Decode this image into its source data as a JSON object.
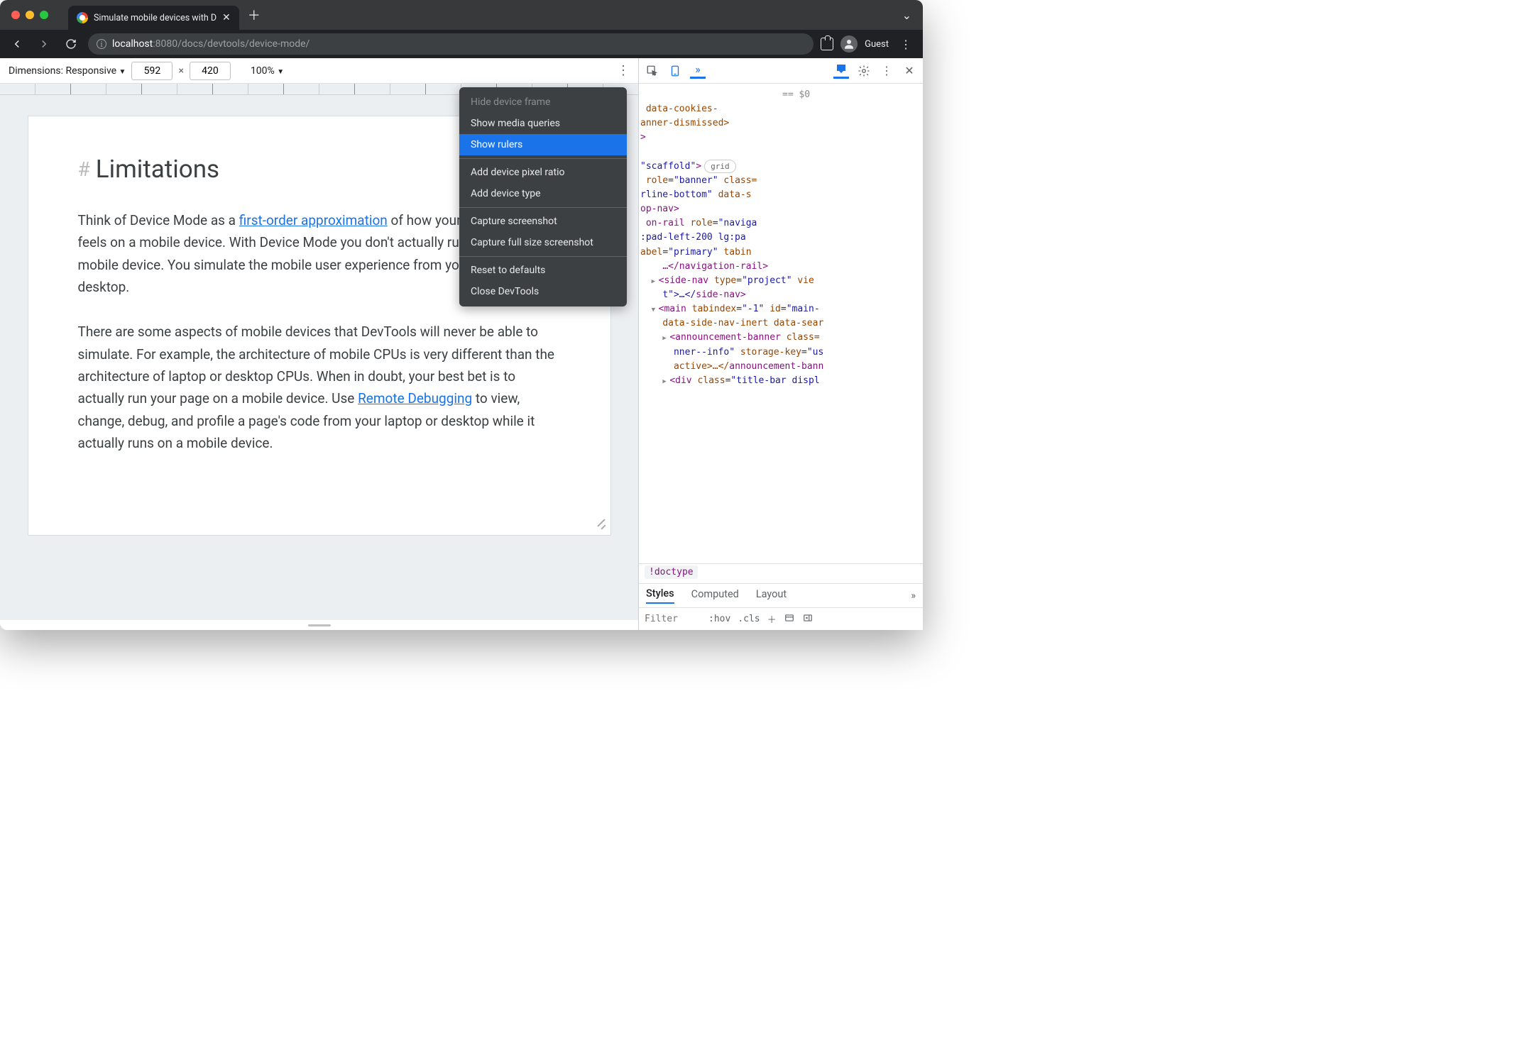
{
  "tab": {
    "title": "Simulate mobile devices with D"
  },
  "url": {
    "host": "localhost",
    "port": ":8080",
    "path": "/docs/devtools/device-mode/"
  },
  "profile": {
    "label": "Guest"
  },
  "device_toolbar": {
    "dimensions_label": "Dimensions: Responsive",
    "width": "592",
    "height": "420",
    "zoom": "100%"
  },
  "context_menu": {
    "hide_frame": "Hide device frame",
    "show_media": "Show media queries",
    "show_rulers": "Show rulers",
    "add_dpr": "Add device pixel ratio",
    "add_type": "Add device type",
    "capture": "Capture screenshot",
    "capture_full": "Capture full size screenshot",
    "reset": "Reset to defaults",
    "close": "Close DevTools"
  },
  "page": {
    "heading": "Limitations",
    "p1a": "Think of Device Mode as a ",
    "p1link": "first-order approximation",
    "p1b": " of how your page looks and feels on a mobile device. With Device Mode you don't actually run your code on a mobile device. You simulate the mobile user experience from your laptop or desktop.",
    "p2a": "There are some aspects of mobile devices that DevTools will never be able to simulate. For example, the architecture of mobile CPUs is very different than the architecture of laptop or desktop CPUs. When in doubt, your best bet is to actually run your page on a mobile device. Use ",
    "p2link": "Remote Debugging",
    "p2b": " to view, change, debug, and profile a page's code from your laptop or desktop while it actually runs on a mobile device."
  },
  "devtools": {
    "ref": "== $0",
    "breadcrumb": "!doctype",
    "filter_placeholder": "Filter",
    "hov": ":hov",
    "cls": ".cls",
    "tabs": {
      "styles": "Styles",
      "computed": "Computed",
      "layout": "Layout"
    },
    "tree": {
      "l1": " data-cookies-",
      "l1b": "anner-dismissed>",
      "l2a": "\"scaffold\"",
      "l2pill": "grid",
      "l3a": "role",
      "l3v": "\"banner\"",
      "l3c": " class=",
      "l4": "rline-bottom\"",
      "l4b": " data-s",
      "l5": "op-nav>",
      "l6a": "on-rail ",
      "l6r": "role",
      "l6v": "\"naviga",
      "l7": ":pad-left-200 lg:pa",
      "l8a": "abel",
      "l8v": "\"primary\"",
      "l8t": " tabin",
      "l9a": "…</",
      "l9t": "navigation-rail",
      "l9b": ">",
      "l10": "side-nav",
      "l10a": "type",
      "l10v": "\"project\"",
      "l10t": " vie",
      "l11a": "t\">…</",
      "l11t": "side-nav",
      "l11b": ">",
      "l12": "main",
      "l12a": "tabindex",
      "l12v": "\"-1\"",
      "l12b": "id",
      "l12c": "\"main-",
      "l13": "data-side-nav-inert data-sear",
      "l14": "announcement-banner",
      "l14a": "class=",
      "l15": "nner--info\"",
      "l15a": "storage-key",
      "l15v": "\"us",
      "l16": "active>…</",
      "l16t": "announcement-bann",
      "l17": "div",
      "l17a": "class",
      "l17v": "\"title-bar displ"
    }
  }
}
